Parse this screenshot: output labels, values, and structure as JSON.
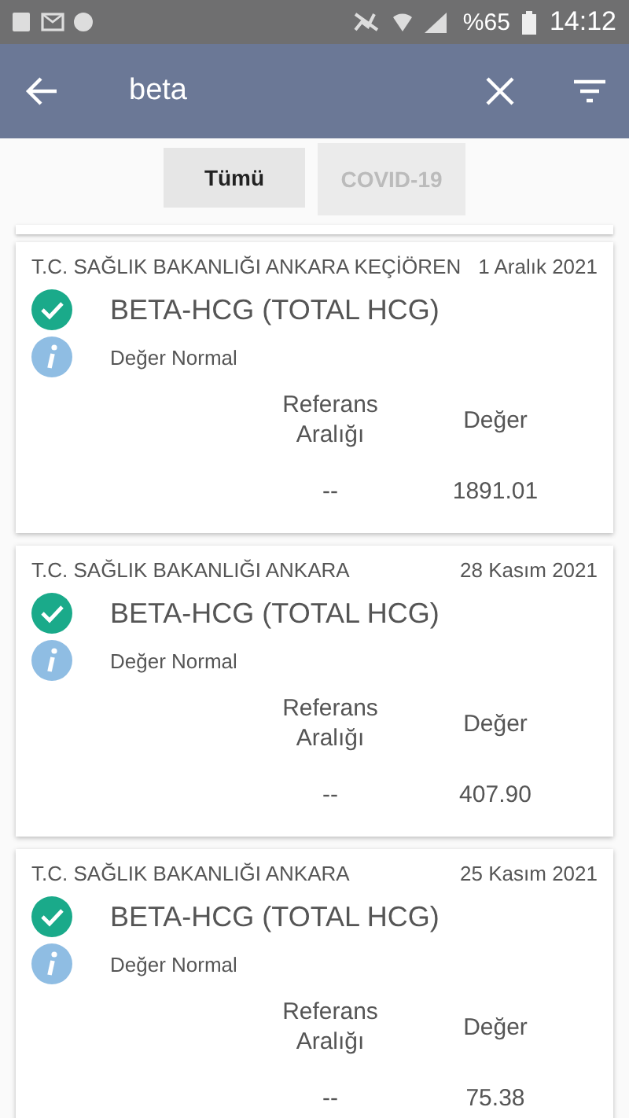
{
  "status_bar": {
    "battery": "%65",
    "time": "14:12"
  },
  "search": {
    "value": "beta"
  },
  "tabs": [
    {
      "label": "Tümü",
      "selected": true
    },
    {
      "label": "COVID-19",
      "selected": false
    }
  ],
  "results": [
    {
      "institution": "T.C. SAĞLIK BAKANLIĞI ANKARA KEÇİÖREN",
      "date": "1 Aralık 2021",
      "test": "BETA-HCG (TOTAL HCG)",
      "status": "Değer Normal",
      "reference_header": "Referans Aralığı",
      "value_header": "Değer",
      "reference": "--",
      "value": "1891.01"
    },
    {
      "institution": "T.C. SAĞLIK BAKANLIĞI ANKARA",
      "date": "28 Kasım 2021",
      "test": "BETA-HCG (TOTAL HCG)",
      "status": "Değer Normal",
      "reference_header": "Referans Aralığı",
      "value_header": "Değer",
      "reference": "--",
      "value": "407.90"
    },
    {
      "institution": "T.C. SAĞLIK BAKANLIĞI ANKARA",
      "date": "25 Kasım 2021",
      "test": "BETA-HCG (TOTAL HCG)",
      "status": "Değer Normal",
      "reference_header": "Referans Aralığı",
      "value_header": "Değer",
      "reference": "--",
      "value": "75.38"
    }
  ]
}
